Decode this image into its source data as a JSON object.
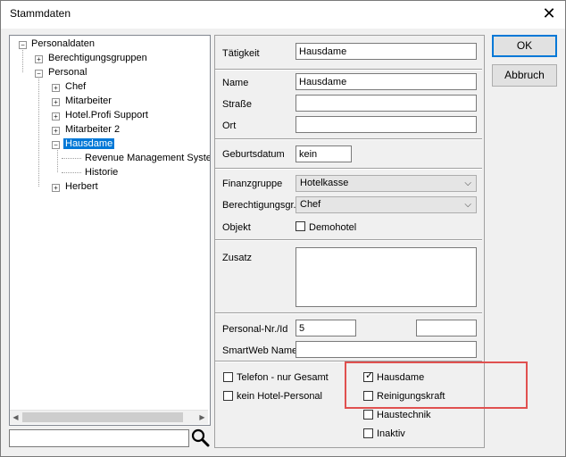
{
  "window": {
    "title": "Stammdaten",
    "close": "✕"
  },
  "tree": {
    "items": [
      {
        "label": "Personaldaten",
        "expander": "−"
      },
      {
        "label": "Berechtigungsgruppen",
        "expander": "+"
      },
      {
        "label": "Personal",
        "expander": "−"
      },
      {
        "label": "Chef",
        "expander": "+"
      },
      {
        "label": "Mitarbeiter",
        "expander": "+"
      },
      {
        "label": "Hotel.Profi Support",
        "expander": "+"
      },
      {
        "label": "Mitarbeiter 2",
        "expander": "+"
      },
      {
        "label": "Hausdame",
        "expander": "−"
      },
      {
        "label": "Revenue Management System"
      },
      {
        "label": "Historie"
      },
      {
        "label": "Herbert",
        "expander": "+"
      }
    ],
    "selected": "Hausdame"
  },
  "search": {
    "value": ""
  },
  "form": {
    "taetigkeit_label": "Tätigkeit",
    "taetigkeit_value": "Hausdame",
    "name_label": "Name",
    "name_value": "Hausdame",
    "strasse_label": "Straße",
    "strasse_value": "",
    "ort_label": "Ort",
    "ort_value": "",
    "geburtsdatum_label": "Geburtsdatum",
    "geburtsdatum_value": "kein",
    "finanzgruppe_label": "Finanzgruppe",
    "finanzgruppe_value": "Hotelkasse",
    "berechtigung_label": "Berechtigungsgr.",
    "berechtigung_value": "Chef",
    "objekt_label": "Objekt",
    "objekt_value": "Demohotel",
    "zusatz_label": "Zusatz",
    "zusatz_value": "",
    "personalnr_label": "Personal-Nr./Id",
    "personalnr_value": "5",
    "personalnr_extra": "",
    "smartweb_label": "SmartWeb Name",
    "smartweb_value": ""
  },
  "checkboxes": {
    "left": [
      {
        "label": "Telefon - nur Gesamt",
        "checked": false
      },
      {
        "label": "kein Hotel-Personal",
        "checked": false
      }
    ],
    "right": [
      {
        "label": "Hausdame",
        "checked": true
      },
      {
        "label": "Reinigungskraft",
        "checked": false
      },
      {
        "label": "Haustechnik",
        "checked": false
      },
      {
        "label": "Inaktiv",
        "checked": false
      }
    ],
    "check_glyph": "✓"
  },
  "buttons": {
    "ok": "OK",
    "cancel": "Abbruch"
  },
  "colors": {
    "selection": "#0078d7",
    "highlight": "#e0504f"
  }
}
